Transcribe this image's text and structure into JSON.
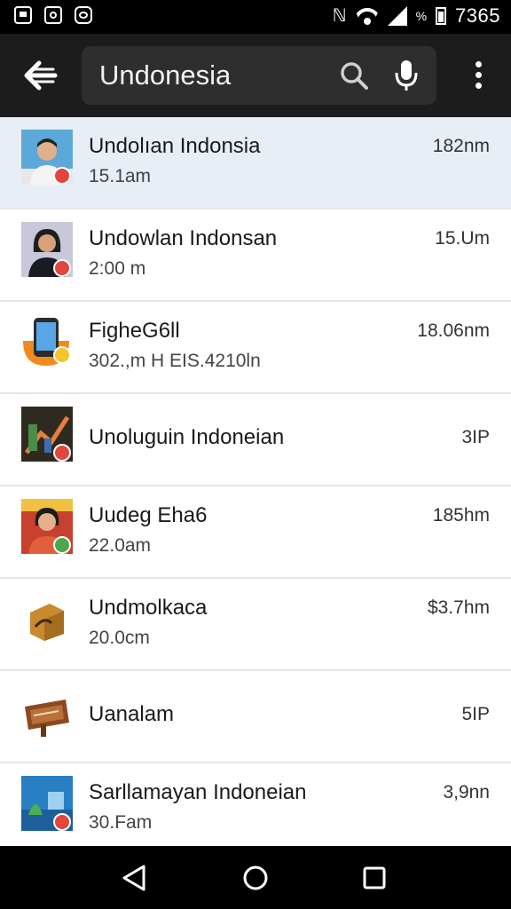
{
  "status_bar": {
    "time": "7365",
    "battery_glyph": "%",
    "icons": [
      "photo-icon",
      "camera-icon",
      "chat-icon",
      "no-nfc-icon",
      "wifi-icon",
      "signal-icon",
      "battery-icon"
    ]
  },
  "toolbar": {
    "search_value": "Undonesia"
  },
  "list": [
    {
      "title": "Undolıan Indonsia",
      "subtitle": "15.1am",
      "meta": "182nm",
      "thumb": "person-male"
    },
    {
      "title": "Undowlan Indonsan",
      "subtitle": "2:00 m",
      "meta": "15.Um",
      "thumb": "person-female"
    },
    {
      "title": "FigheG6ll",
      "subtitle": "302.,m H EIS.4210ln",
      "meta": "18.06nm",
      "thumb": "phone-app"
    },
    {
      "title": "Unoluguin Indoneian",
      "subtitle": "",
      "meta": "3IP",
      "thumb": "chart-art"
    },
    {
      "title": "Uudeg Eha6",
      "subtitle": "22.0am",
      "meta": "185hm",
      "thumb": "person-poster"
    },
    {
      "title": "Undmolkaca",
      "subtitle": "20.0cm",
      "meta": "$3.7hm",
      "thumb": "box"
    },
    {
      "title": "Uanalam",
      "subtitle": "",
      "meta": "5IP",
      "thumb": "sign-board"
    },
    {
      "title": "Sarllamayan Indoneian",
      "subtitle": "30.Fam",
      "meta": "3,9nn",
      "thumb": "landscape"
    }
  ],
  "colors": {
    "status_bg": "#000000",
    "toolbar_bg": "#1c1c1c",
    "search_bg": "#2e2e2e",
    "selected_row": "#e7eef6",
    "badge": "#e2463c"
  }
}
